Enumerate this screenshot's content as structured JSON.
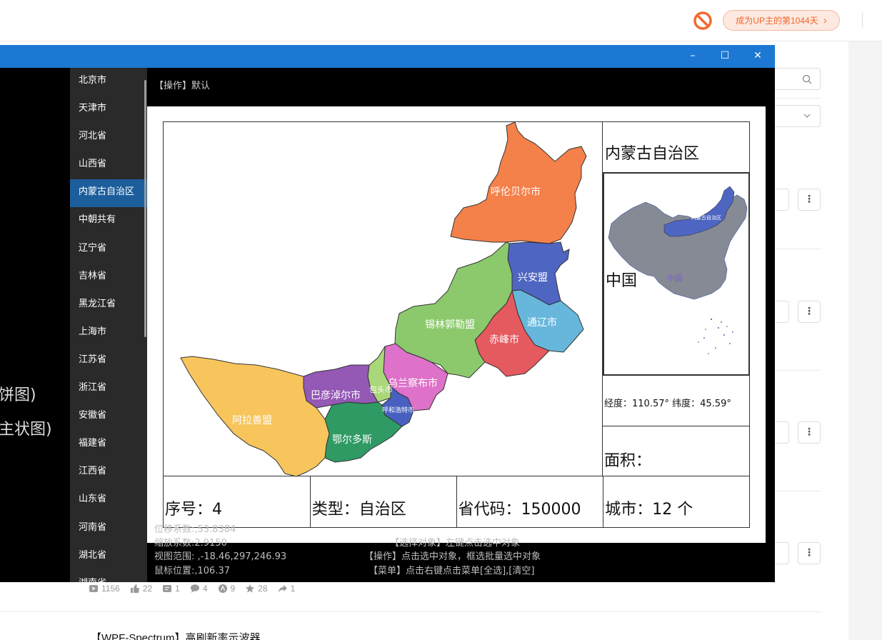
{
  "header": {
    "up_days_label": "成为UP主的第1044天",
    "up_days_arrow": "›"
  },
  "window": {
    "minimize": "–",
    "maximize": "☐",
    "close": "✕",
    "left_texts": [
      "饼图)",
      "主状图)"
    ]
  },
  "provinces": {
    "items": [
      "北京市",
      "天津市",
      "河北省",
      "山西省",
      "内蒙古自治区",
      "中朝共有",
      "辽宁省",
      "吉林省",
      "黑龙江省",
      "上海市",
      "江苏省",
      "浙江省",
      "安徽省",
      "福建省",
      "江西省",
      "山东省",
      "河南省",
      "湖北省",
      "湖南省"
    ],
    "active_index": 4
  },
  "operation_label": "【操作】默认",
  "region": {
    "title": "内蒙古自治区",
    "coords": "经度：110.57° 纬度：45.59°",
    "area": "面积：",
    "index": "序号：4",
    "type": "类型：自治区",
    "code": "省代码：150000",
    "cities": "城市：12 个"
  },
  "map": {
    "cities": [
      {
        "name": "呼伦贝尔市",
        "color": "#f4804a"
      },
      {
        "name": "兴安盟",
        "color": "#4e65c2"
      },
      {
        "name": "通辽市",
        "color": "#67b7dc"
      },
      {
        "name": "赤峰市",
        "color": "#e55a5f"
      },
      {
        "name": "锡林郭勒盟",
        "color": "#8cc96d"
      },
      {
        "name": "乌兰察布市",
        "color": "#de71c9"
      },
      {
        "name": "包头市",
        "color": "#a9d77a"
      },
      {
        "name": "呼和浩特市",
        "color": "#4861c0"
      },
      {
        "name": "巴彦淖尔市",
        "color": "#9458b5"
      },
      {
        "name": "鄂尔多斯",
        "color": "#2f9a64"
      },
      {
        "name": "阿拉善盟",
        "color": "#f7c55b"
      }
    ],
    "minimap_region_label": "内蒙古自治区",
    "minimap_country_label": "中国",
    "country_label": "中国"
  },
  "status": {
    "offset": "位移系数:,53.8384",
    "zoom": "缩放系数:2.9150",
    "view_range": "视图范围: ,-18.46,297,246.93",
    "mouse_pos": "鼠标位置:,106.37",
    "tip_select": "【选择对象】左键点击选中对象",
    "tip_operate": "【操作】点击选中对象，框选批量选中对象",
    "tip_menu": "【菜单】点击右键点击菜单[全选],[清空]"
  },
  "stats": {
    "views": "1156",
    "likes": "22",
    "coins": "1",
    "comments": "4",
    "charge": "9",
    "favorites": "28",
    "shares": "1"
  },
  "next_video_title": "【WPF-Spectrum】高刷新率示波器"
}
